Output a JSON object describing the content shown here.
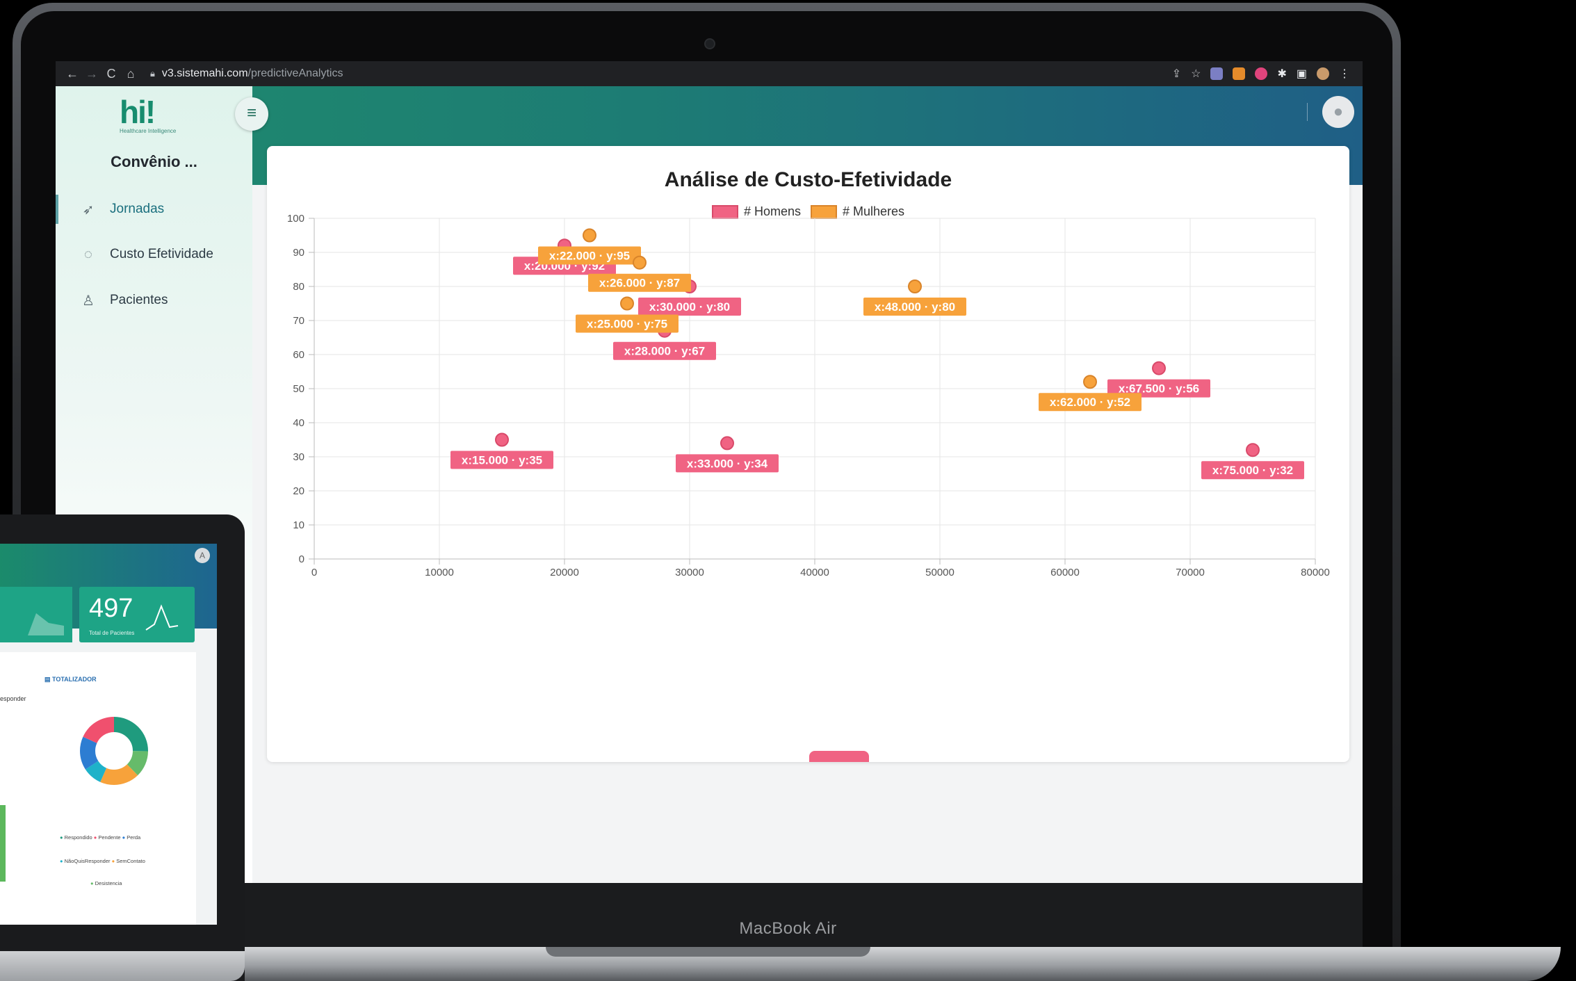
{
  "device": {
    "model_label": "MacBook Air"
  },
  "browser": {
    "url_host": "v3.sistemahi.com",
    "url_path": "/predictiveAnalytics"
  },
  "logo": {
    "text": "hi!",
    "subtitle": "Healthcare Intelligence"
  },
  "sidebar": {
    "org_name": "Convênio ...",
    "items": [
      {
        "label": "Jornadas",
        "icon": "paper-plane-icon",
        "active": true
      },
      {
        "label": "Custo Efetividade",
        "icon": "refresh-icon",
        "active": false
      },
      {
        "label": "Pacientes",
        "icon": "user-icon",
        "active": false
      }
    ]
  },
  "colors": {
    "homens": "#f06383",
    "homens_border": "#d94a6a",
    "mulheres": "#f7a23b",
    "mulheres_border": "#d9842a",
    "header_start": "#1f8a6d",
    "header_end": "#1f5f86"
  },
  "chart_data": {
    "type": "scatter",
    "title": "Análise de Custo-Efetividade",
    "xlim": [
      0,
      80000
    ],
    "ylim": [
      0,
      100
    ],
    "x_ticks": [
      "0",
      "10000",
      "20000",
      "30000",
      "40000",
      "50000",
      "60000",
      "70000",
      "80000"
    ],
    "y_ticks": [
      "0",
      "10",
      "20",
      "30",
      "40",
      "50",
      "60",
      "70",
      "80",
      "90",
      "100"
    ],
    "grid": true,
    "legend_position": "top",
    "series": [
      {
        "name": "# Homens",
        "color": "#f06383",
        "points": [
          {
            "x": 15000,
            "y": 35,
            "label": "x:15.000 · y:35"
          },
          {
            "x": 20000,
            "y": 92,
            "label": "x:20.000 · y:92"
          },
          {
            "x": 28000,
            "y": 67,
            "label": "x:28.000 · y:67"
          },
          {
            "x": 30000,
            "y": 80,
            "label": "x:30.000 · y:80"
          },
          {
            "x": 33000,
            "y": 34,
            "label": "x:33.000 · y:34"
          },
          {
            "x": 67500,
            "y": 56,
            "label": "x:67.500 · y:56"
          },
          {
            "x": 75000,
            "y": 32,
            "label": "x:75.000 · y:32"
          }
        ]
      },
      {
        "name": "# Mulheres",
        "color": "#f7a23b",
        "points": [
          {
            "x": 22000,
            "y": 95,
            "label": "x:22.000 · y:95"
          },
          {
            "x": 26000,
            "y": 87,
            "label": "x:26.000 · y:87"
          },
          {
            "x": 25000,
            "y": 75,
            "label": "x:25.000 · y:75"
          },
          {
            "x": 48000,
            "y": 80,
            "label": "x:48.000 · y:80"
          },
          {
            "x": 62000,
            "y": 52,
            "label": "x:62.000 · y:52"
          }
        ]
      }
    ]
  },
  "tablet": {
    "total_pacientes_value": "497",
    "total_pacientes_label": "Total de Pacientes",
    "totalizador_label": "TOTALIZADOR",
    "responder_text": "esponder",
    "donut_legend": [
      "Respondido",
      "Pendente",
      "Perda",
      "NãoQuisResponder",
      "SemContato",
      "Desistencia"
    ]
  }
}
